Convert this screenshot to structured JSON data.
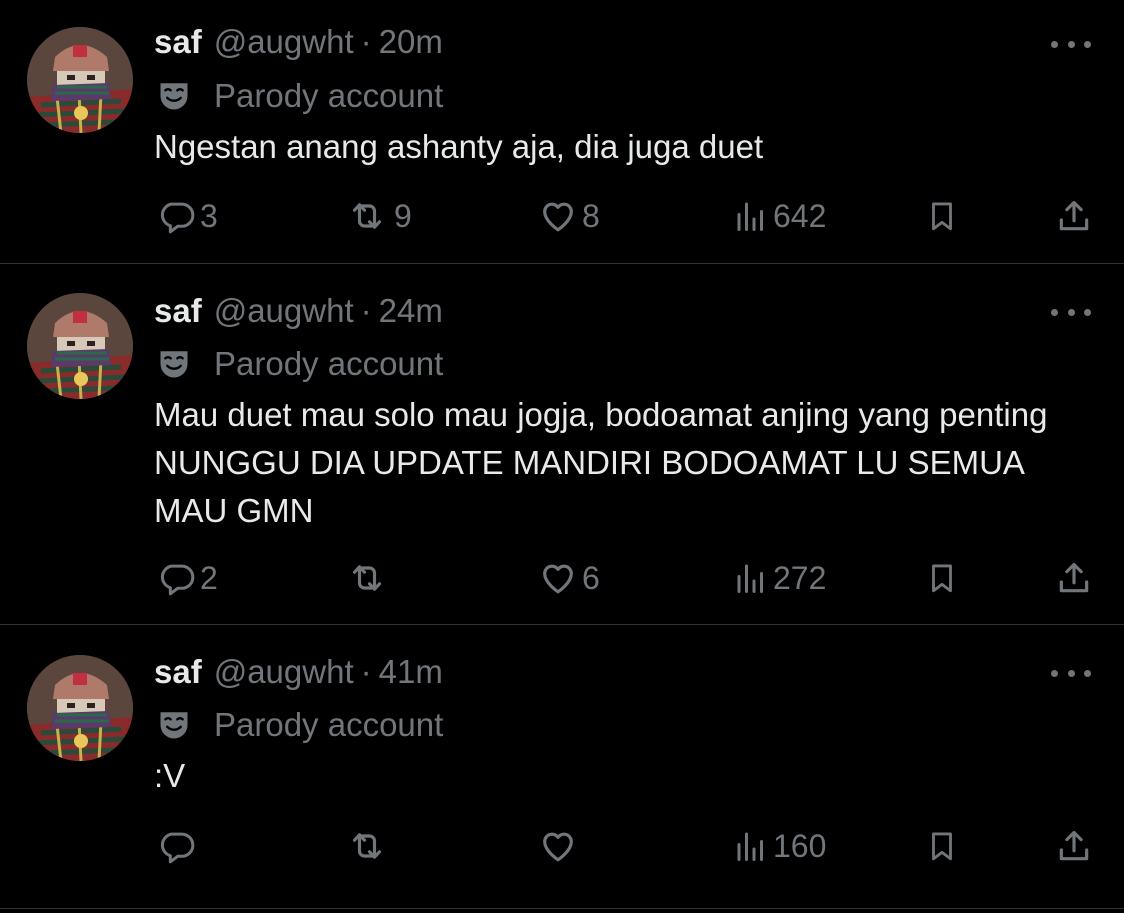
{
  "colors": {
    "background": "#000000",
    "text_primary": "#e7e9ea",
    "text_secondary": "#71767b",
    "divider": "#2f3336"
  },
  "icons": {
    "reply": "reply-icon",
    "retweet": "retweet-icon",
    "like": "like-icon",
    "views": "views-icon",
    "bookmark": "bookmark-icon",
    "share": "share-icon",
    "more": "more-icon",
    "parody": "parody-mask-icon"
  },
  "tweets": [
    {
      "name": "saf",
      "handle": "@augwht",
      "separator": "·",
      "time": "20m",
      "label": "Parody account",
      "text": "Ngestan anang ashanty aja, dia juga duet",
      "replies": "3",
      "retweets": "9",
      "likes": "8",
      "views": "642"
    },
    {
      "name": "saf",
      "handle": "@augwht",
      "separator": "·",
      "time": "24m",
      "label": "Parody account",
      "text": "Mau duet mau solo mau jogja, bodoamat anjing yang penting NUNGGU DIA UPDATE MANDIRI BODOAMAT LU SEMUA MAU GMN",
      "replies": "2",
      "retweets": "",
      "likes": "6",
      "views": "272"
    },
    {
      "name": "saf",
      "handle": "@augwht",
      "separator": "·",
      "time": "41m",
      "label": "Parody account",
      "text": ":V",
      "replies": "",
      "retweets": "",
      "likes": "",
      "views": "160"
    }
  ]
}
